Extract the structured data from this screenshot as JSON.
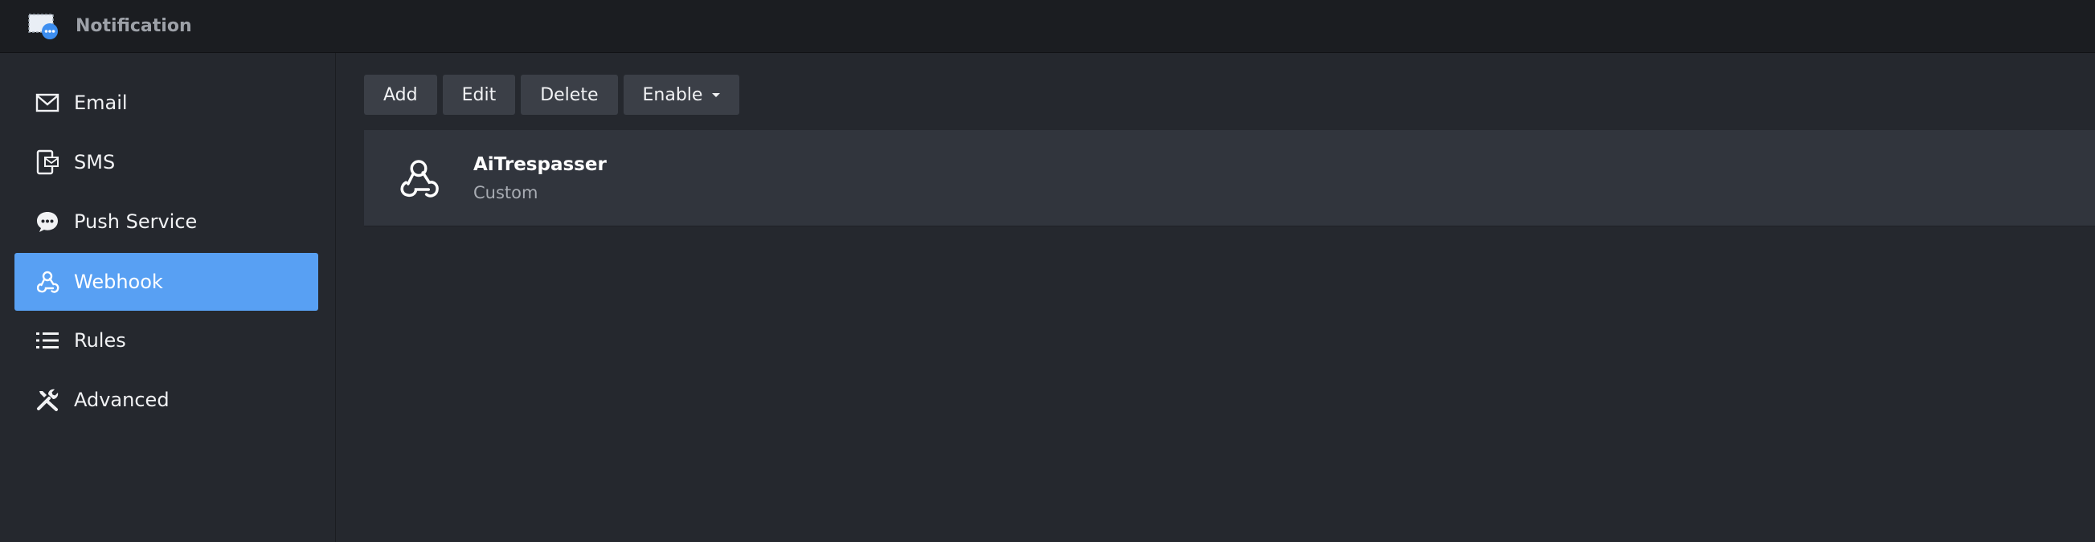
{
  "app": {
    "title": "Notification",
    "icon": "notification-app-icon"
  },
  "sidebar": {
    "items": [
      {
        "label": "Email",
        "icon": "envelope-icon",
        "active": false
      },
      {
        "label": "SMS",
        "icon": "sms-phone-icon",
        "active": false
      },
      {
        "label": "Push Service",
        "icon": "chat-bubble-icon",
        "active": false
      },
      {
        "label": "Webhook",
        "icon": "webhook-icon",
        "active": true
      },
      {
        "label": "Rules",
        "icon": "list-icon",
        "active": false
      },
      {
        "label": "Advanced",
        "icon": "tools-icon",
        "active": false
      }
    ]
  },
  "toolbar": {
    "add_label": "Add",
    "edit_label": "Edit",
    "delete_label": "Delete",
    "enable_label": "Enable"
  },
  "webhooks": [
    {
      "name": "AiTrespasser",
      "type": "Custom",
      "icon": "webhook-icon"
    }
  ],
  "colors": {
    "accent": "#58a0f3",
    "titlebar": "#1b1d21",
    "background": "#25282e",
    "button": "#3b3f47",
    "row": "#31353d"
  }
}
